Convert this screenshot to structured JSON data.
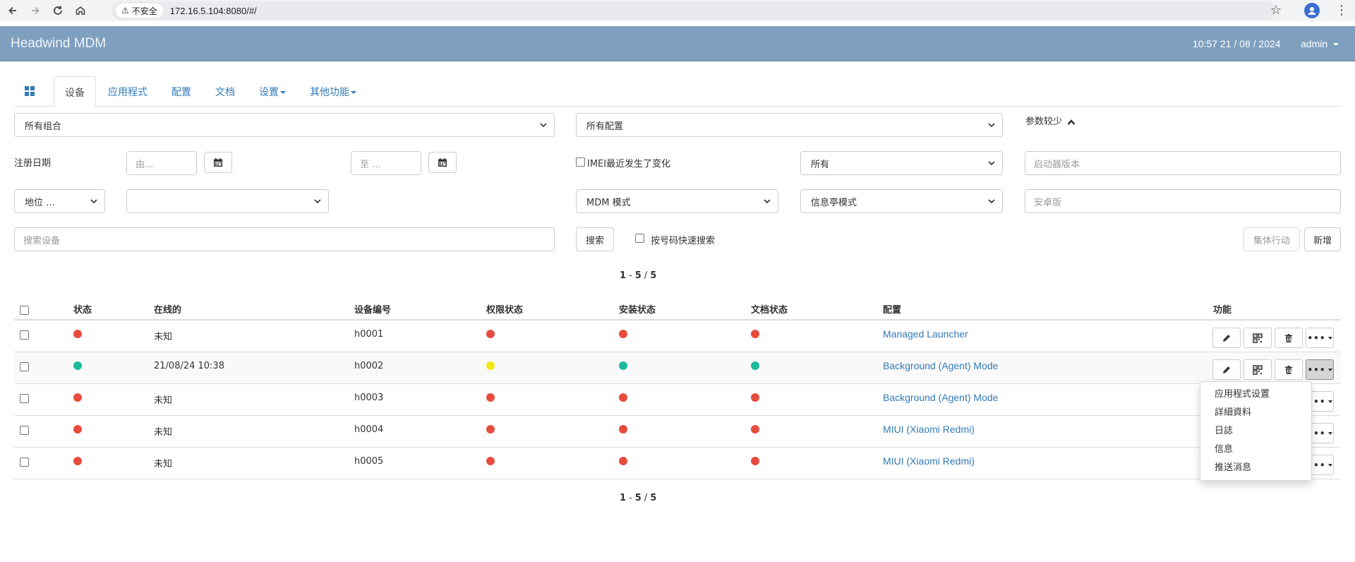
{
  "browser": {
    "security_label": "不安全",
    "url": "172.16.5.104:8080/#/"
  },
  "app": {
    "brand": "Headwind MDM",
    "datetime": "10:57 21 / 08 / 2024",
    "user": "admin"
  },
  "tabs": [
    {
      "label": ""
    },
    {
      "label": "设备"
    },
    {
      "label": "应用程式"
    },
    {
      "label": "配置"
    },
    {
      "label": "文档"
    },
    {
      "label": "设置"
    },
    {
      "label": "其他功能"
    }
  ],
  "filters": {
    "group_select": "所有组合",
    "config_select": "所有配置",
    "params_toggle": "参数较少",
    "reg_date_label": "注册日期",
    "date_from_placeholder": "由...",
    "date_to_placeholder": "至 ...",
    "imei_changed_label": "IMEI最近发生了变化",
    "imei_select": "所有",
    "launcher_version_placeholder": "启动器版本",
    "location_select": "地位 ...",
    "location_value_select": "",
    "mdm_mode_select": "MDM 模式",
    "kiosk_mode_select": "信息亭模式",
    "android_version_placeholder": "安卓版",
    "search_placeholder": "搜索设备",
    "search_button": "搜索",
    "quick_search_label": "按号码快速搜索",
    "bulk_action_button": "集体行动",
    "new_button": "新增"
  },
  "pagination": {
    "from": "1",
    "to": "5",
    "total": "5",
    "dash": "-",
    "slash": "/"
  },
  "table": {
    "headers": [
      "状态",
      "在线的",
      "设备编号",
      "权限状态",
      "安装状态",
      "文档状态",
      "配置",
      "功能"
    ],
    "rows": [
      {
        "online": "未知",
        "number": "h0001",
        "config": "Managed Launcher",
        "status": "red",
        "perm": "red",
        "install": "red",
        "files": "red"
      },
      {
        "online": "21/08/24 10:38",
        "number": "h0002",
        "config": "Background (Agent) Mode",
        "status": "green",
        "perm": "yellow",
        "install": "green",
        "files": "green"
      },
      {
        "online": "未知",
        "number": "h0003",
        "config": "Background (Agent) Mode",
        "status": "red",
        "perm": "red",
        "install": "red",
        "files": "red"
      },
      {
        "online": "未知",
        "number": "h0004",
        "config": "MIUI (Xiaomi Redmi)",
        "status": "red",
        "perm": "red",
        "install": "red",
        "files": "red"
      },
      {
        "online": "未知",
        "number": "h0005",
        "config": "MIUI (Xiaomi Redmi)",
        "status": "red",
        "perm": "red",
        "install": "red",
        "files": "red"
      }
    ]
  },
  "row_menu": {
    "items": [
      "应用程式设置",
      "詳細資料",
      "日誌",
      "信息",
      "推送消息"
    ]
  },
  "colors": {
    "red": "#e74c3c",
    "green": "#1abc9c",
    "yellow": "#f1e60f",
    "navbar": "#7f9fbf",
    "link": "#337ab7"
  }
}
